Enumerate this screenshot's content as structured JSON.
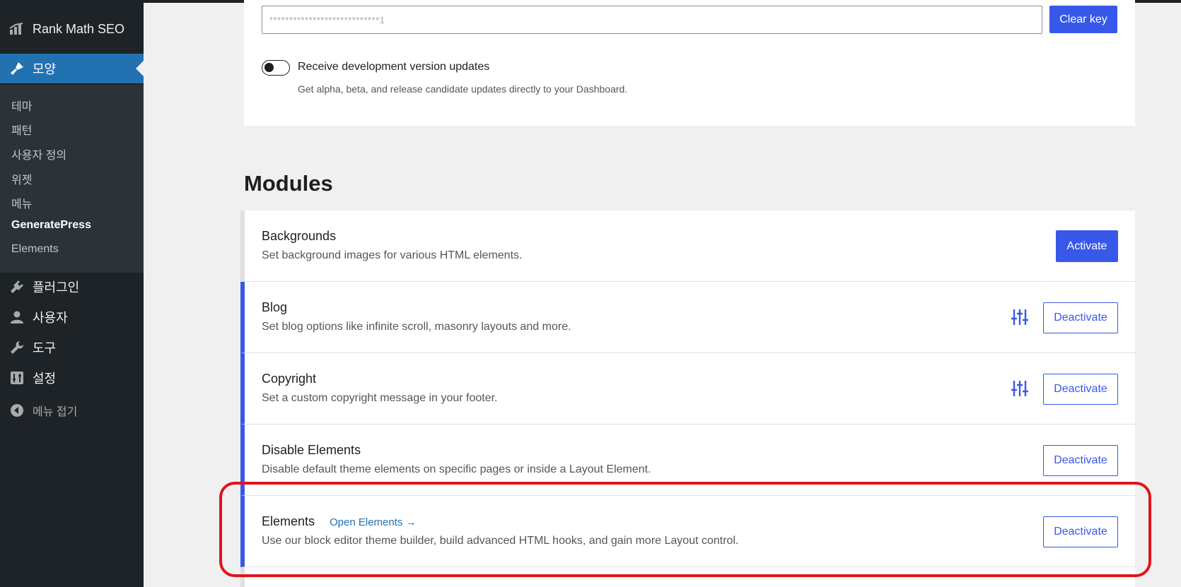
{
  "sidebar": {
    "top_item": {
      "label": "Rank Math SEO",
      "icon": "rank-math-icon"
    },
    "active_item": {
      "label": "모양",
      "icon": "paintbrush-icon"
    },
    "submenu": [
      {
        "label": "테마"
      },
      {
        "label": "패턴"
      },
      {
        "label": "사용자 정의"
      },
      {
        "label": "위젯"
      },
      {
        "label": "메뉴"
      },
      {
        "label": "GeneratePress"
      },
      {
        "label": "Elements"
      }
    ],
    "items": [
      {
        "label": "플러그인",
        "icon": "plugin-icon"
      },
      {
        "label": "사용자",
        "icon": "user-icon"
      },
      {
        "label": "도구",
        "icon": "wrench-icon"
      },
      {
        "label": "설정",
        "icon": "settings-icon"
      }
    ],
    "collapse": {
      "label": "메뉴 접기",
      "icon": "collapse-icon"
    }
  },
  "license": {
    "key_value": "****************************1",
    "clear_label": "Clear key",
    "toggle_label": "Receive development version updates",
    "toggle_help": "Get alpha, beta, and release candidate updates directly to your Dashboard.",
    "toggle_on": false
  },
  "modules": {
    "title": "Modules",
    "items": [
      {
        "name": "Backgrounds",
        "desc": "Set background images for various HTML elements.",
        "action": "Activate",
        "active": false,
        "has_settings": false,
        "link": ""
      },
      {
        "name": "Blog",
        "desc": "Set blog options like infinite scroll, masonry layouts and more.",
        "action": "Deactivate",
        "active": true,
        "has_settings": true,
        "link": ""
      },
      {
        "name": "Copyright",
        "desc": "Set a custom copyright message in your footer.",
        "action": "Deactivate",
        "active": true,
        "has_settings": true,
        "link": ""
      },
      {
        "name": "Disable Elements",
        "desc": "Disable default theme elements on specific pages or inside a Layout Element.",
        "action": "Deactivate",
        "active": true,
        "has_settings": false,
        "link": ""
      },
      {
        "name": "Elements",
        "desc": "Use our block editor theme builder, build advanced HTML hooks, and gain more Layout control.",
        "action": "Deactivate",
        "active": true,
        "has_settings": false,
        "link": "Open Elements →"
      }
    ]
  },
  "colors": {
    "accent": "#3858e9",
    "sidebar_bg": "#1d2327",
    "active_menu": "#2271b1",
    "highlight": "#e0141a"
  }
}
